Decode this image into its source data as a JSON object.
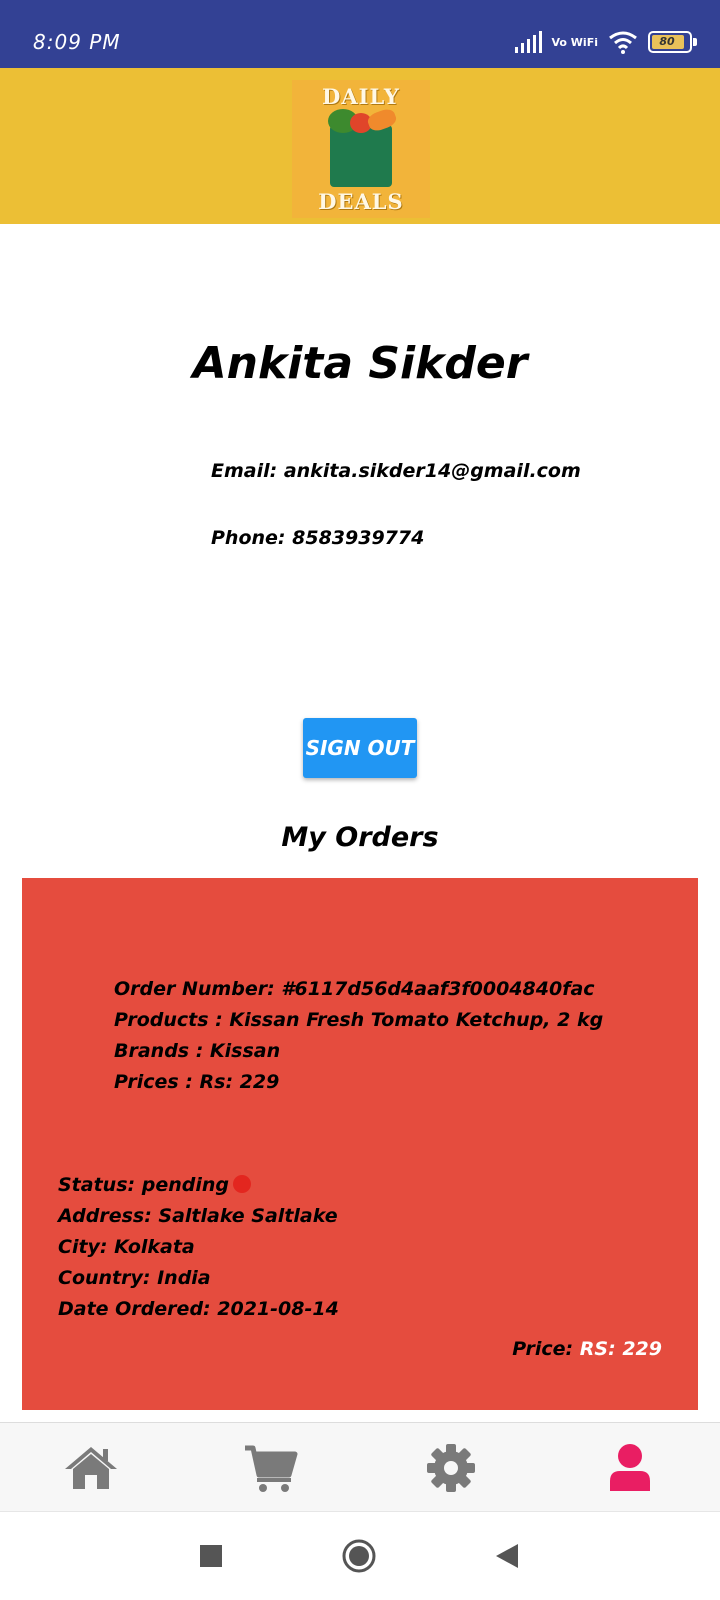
{
  "status_bar": {
    "time": "8:09 PM",
    "network": "Vo WiFi",
    "battery": "80"
  },
  "header": {
    "logo_top": "DAILY",
    "logo_bottom": "DEALS"
  },
  "profile": {
    "name": "Ankita Sikder",
    "email": "Email: ankita.sikder14@gmail.com",
    "phone": "Phone: 8583939774",
    "signout_label": "SIGN OUT"
  },
  "orders": {
    "title": "My Orders",
    "items": [
      {
        "order_number": "Order Number: #6117d56d4aaf3f0004840fac",
        "products": "Products : Kissan Fresh Tomato Ketchup, 2 kg",
        "brands": "Brands : Kissan",
        "prices": "Prices : Rs: 229",
        "status": "Status: pending",
        "address": "Address: Saltlake Saltlake",
        "city": "City: Kolkata",
        "country": "Country: India",
        "date": "Date Ordered: 2021-08-14",
        "price_label": "Price:",
        "price_value": "RS: 229"
      }
    ]
  },
  "colors": {
    "status_bar": "#334194",
    "header": "#ecbf35",
    "order_card": "#e54c3e",
    "button": "#2196f3",
    "active_nav": "#e91e63",
    "inactive_nav": "#7a7a7a"
  },
  "bottom_nav": {
    "items": [
      "home-icon",
      "cart-icon",
      "settings-icon",
      "profile-icon"
    ],
    "active": "profile-icon"
  },
  "system_nav": [
    "recent-apps-icon",
    "home-circle-icon",
    "back-icon"
  ]
}
